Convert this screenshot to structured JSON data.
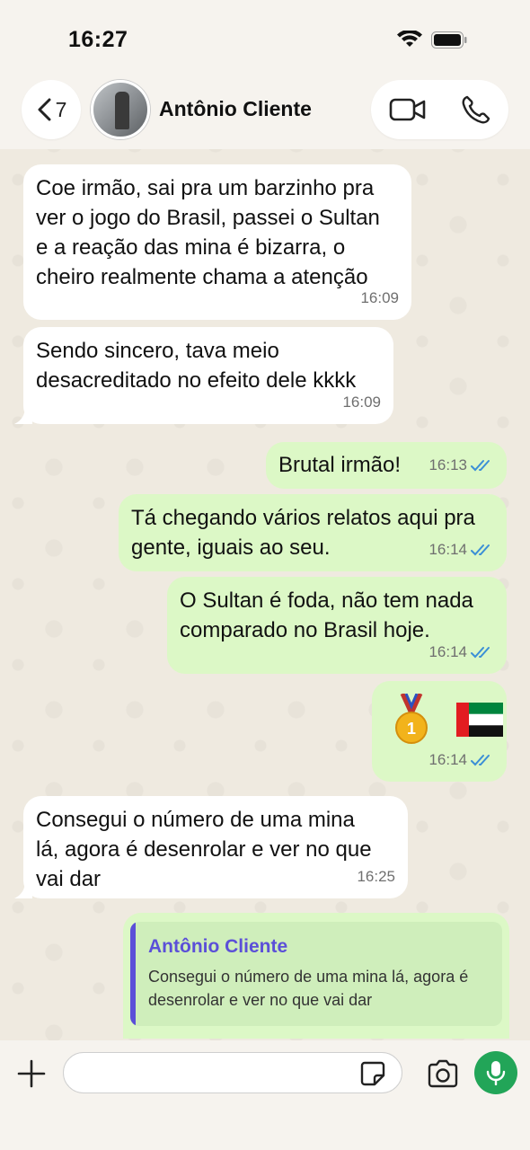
{
  "status_bar": {
    "time": "16:27"
  },
  "header": {
    "back_count": "7",
    "contact_name": "Antônio Cliente"
  },
  "messages": [
    {
      "direction": "in",
      "text": "Coe irmão, sai pra um barzinho pra\nver o jogo do Brasil, passei o Sultan\ne a reação das mina é bizarra, o\ncheiro realmente chama a atenção",
      "time": "16:09"
    },
    {
      "direction": "in",
      "text": "Sendo sincero, tava meio\ndesacreditado no efeito dele kkkk",
      "time": "16:09"
    },
    {
      "direction": "out",
      "text": "Brutal irmão!",
      "time": "16:13",
      "status": "read"
    },
    {
      "direction": "out",
      "text": "Tá chegando vários relatos aqui pra\ngente, iguais ao seu.",
      "time": "16:14",
      "status": "read"
    },
    {
      "direction": "out",
      "text": "O Sultan é foda, não tem nada\ncomparado no Brasil hoje.",
      "time": "16:14",
      "status": "read"
    },
    {
      "direction": "out",
      "text": "🥇 🇦🇪",
      "time": "16:14",
      "status": "read"
    },
    {
      "direction": "in",
      "text": "Consegui o número de uma mina\nlá, agora é desenrolar e ver no que\nvai dar",
      "time": "16:25"
    }
  ],
  "reply": {
    "quoted_name": "Antônio Cliente",
    "quoted_text": "Consegui o número de uma mina lá, agora é desenrolar e ver no que vai dar"
  },
  "input": {
    "placeholder": ""
  },
  "colors": {
    "incoming": "#ffffff",
    "outgoing": "#dcf8c6",
    "read_ticks": "#3b8fd6",
    "mic": "#22a558",
    "quote_accent": "#5b4fd8"
  }
}
